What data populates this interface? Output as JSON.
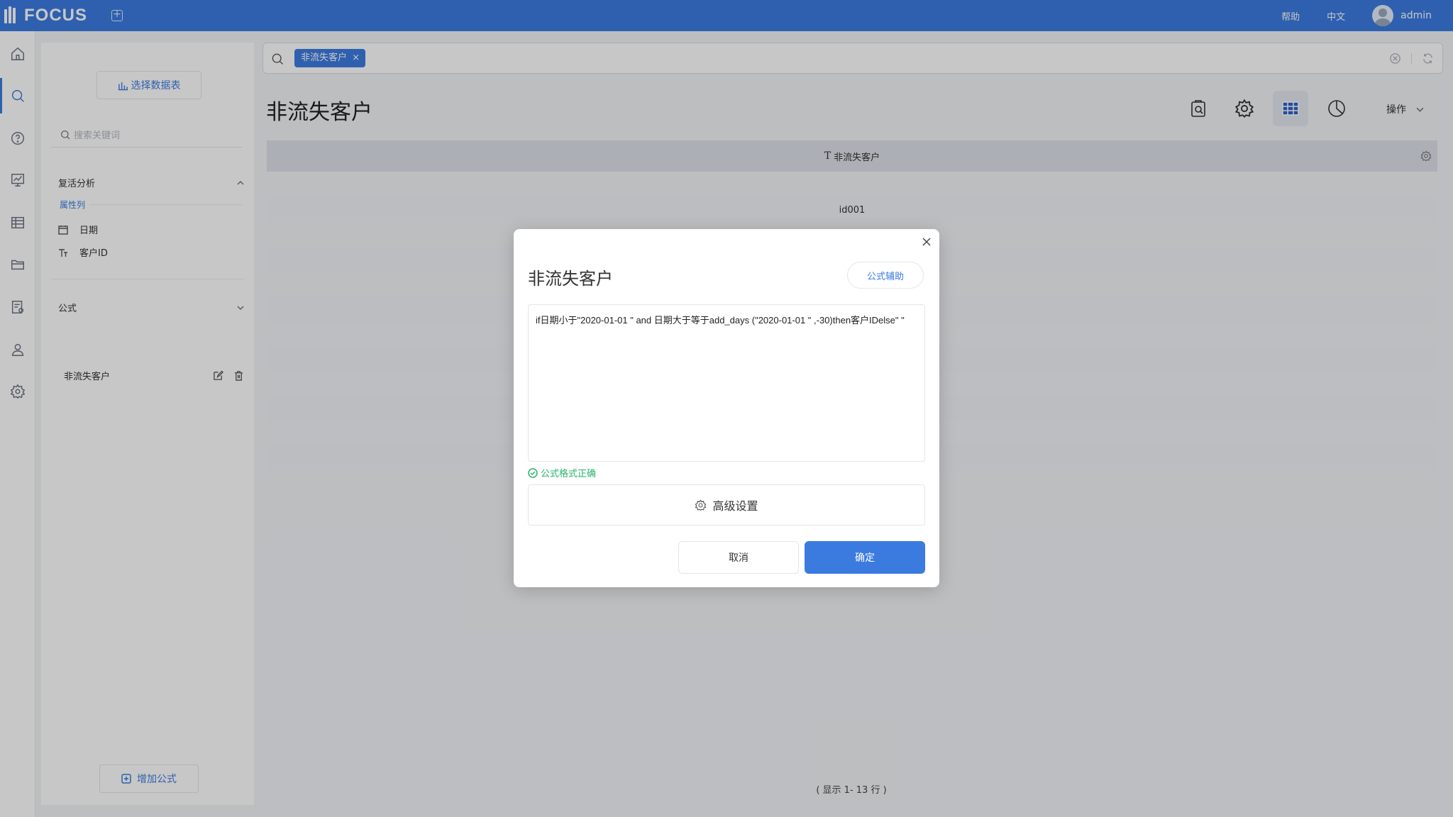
{
  "topbar": {
    "logo_text": "FOCUS",
    "help": "帮助",
    "language": "中文",
    "user": "admin"
  },
  "rail": {
    "icons": [
      "home-icon",
      "search-icon",
      "help-icon",
      "dashboard-icon",
      "table-icon",
      "folder-icon",
      "report-icon",
      "user-icon",
      "settings-icon"
    ],
    "active": "search-icon"
  },
  "panel": {
    "select_table": "选择数据表",
    "search_placeholder": "搜索关键词",
    "dataset_name": "复活分析",
    "attribute_label": "属性列",
    "fields": [
      {
        "label": "日期",
        "type": "date"
      },
      {
        "label": "客户ID",
        "type": "text"
      }
    ],
    "formula_section": "公式",
    "formulas": [
      "非流失客户"
    ],
    "add_formula": "增加公式"
  },
  "search": {
    "tag": "非流失客户"
  },
  "main": {
    "title": "非流失客户",
    "ops_label": "操作",
    "column_header": "非流失客户",
    "rows": [
      "id001",
      "",
      "",
      "",
      "",
      ""
    ],
    "row_count": "( 显示 1- 13 行 )"
  },
  "dialog": {
    "title": "非流失客户",
    "assist": "公式辅助",
    "formula": "if日期小于\"2020-01-01 \" and 日期大于等于add_days (\"2020-01-01 \" ,-30)then客户IDelse\" \"",
    "valid_text": "公式格式正确",
    "advanced": "高级设置",
    "cancel": "取消",
    "ok": "确定"
  },
  "colors": {
    "primary": "#3b7be0",
    "success": "#27b36b"
  }
}
